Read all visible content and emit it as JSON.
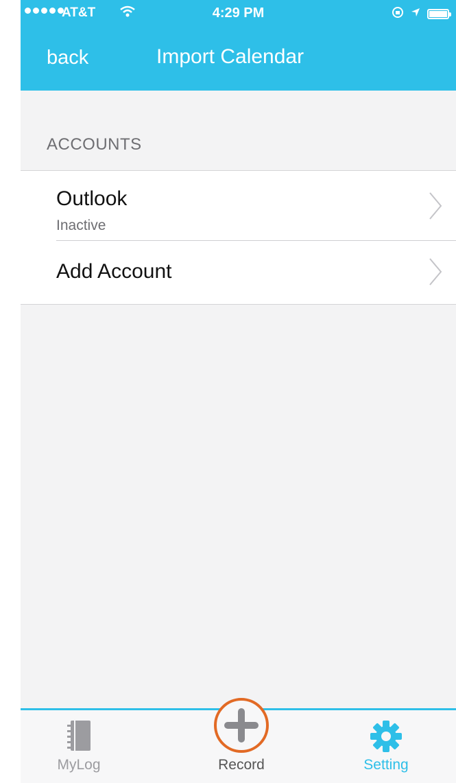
{
  "status_bar": {
    "carrier": "AT&T",
    "time": "4:29 PM",
    "signal_dots": 5,
    "battery_level": 1.0
  },
  "nav": {
    "back_label": "back",
    "title": "Import Calendar"
  },
  "section": {
    "header": "ACCOUNTS"
  },
  "accounts": [
    {
      "title": "Outlook",
      "subtitle": "Inactive"
    },
    {
      "title": "Add Account"
    }
  ],
  "tabbar": {
    "items": [
      {
        "label": "MyLog",
        "icon": "notebook-icon"
      },
      {
        "label": "Record",
        "icon": "plus-circle-icon"
      },
      {
        "label": "Setting",
        "icon": "gear-icon"
      }
    ],
    "selected": "Setting"
  },
  "colors": {
    "accent": "#2ebfe8",
    "record_ring": "#e26a25",
    "background": "#f3f3f4"
  }
}
